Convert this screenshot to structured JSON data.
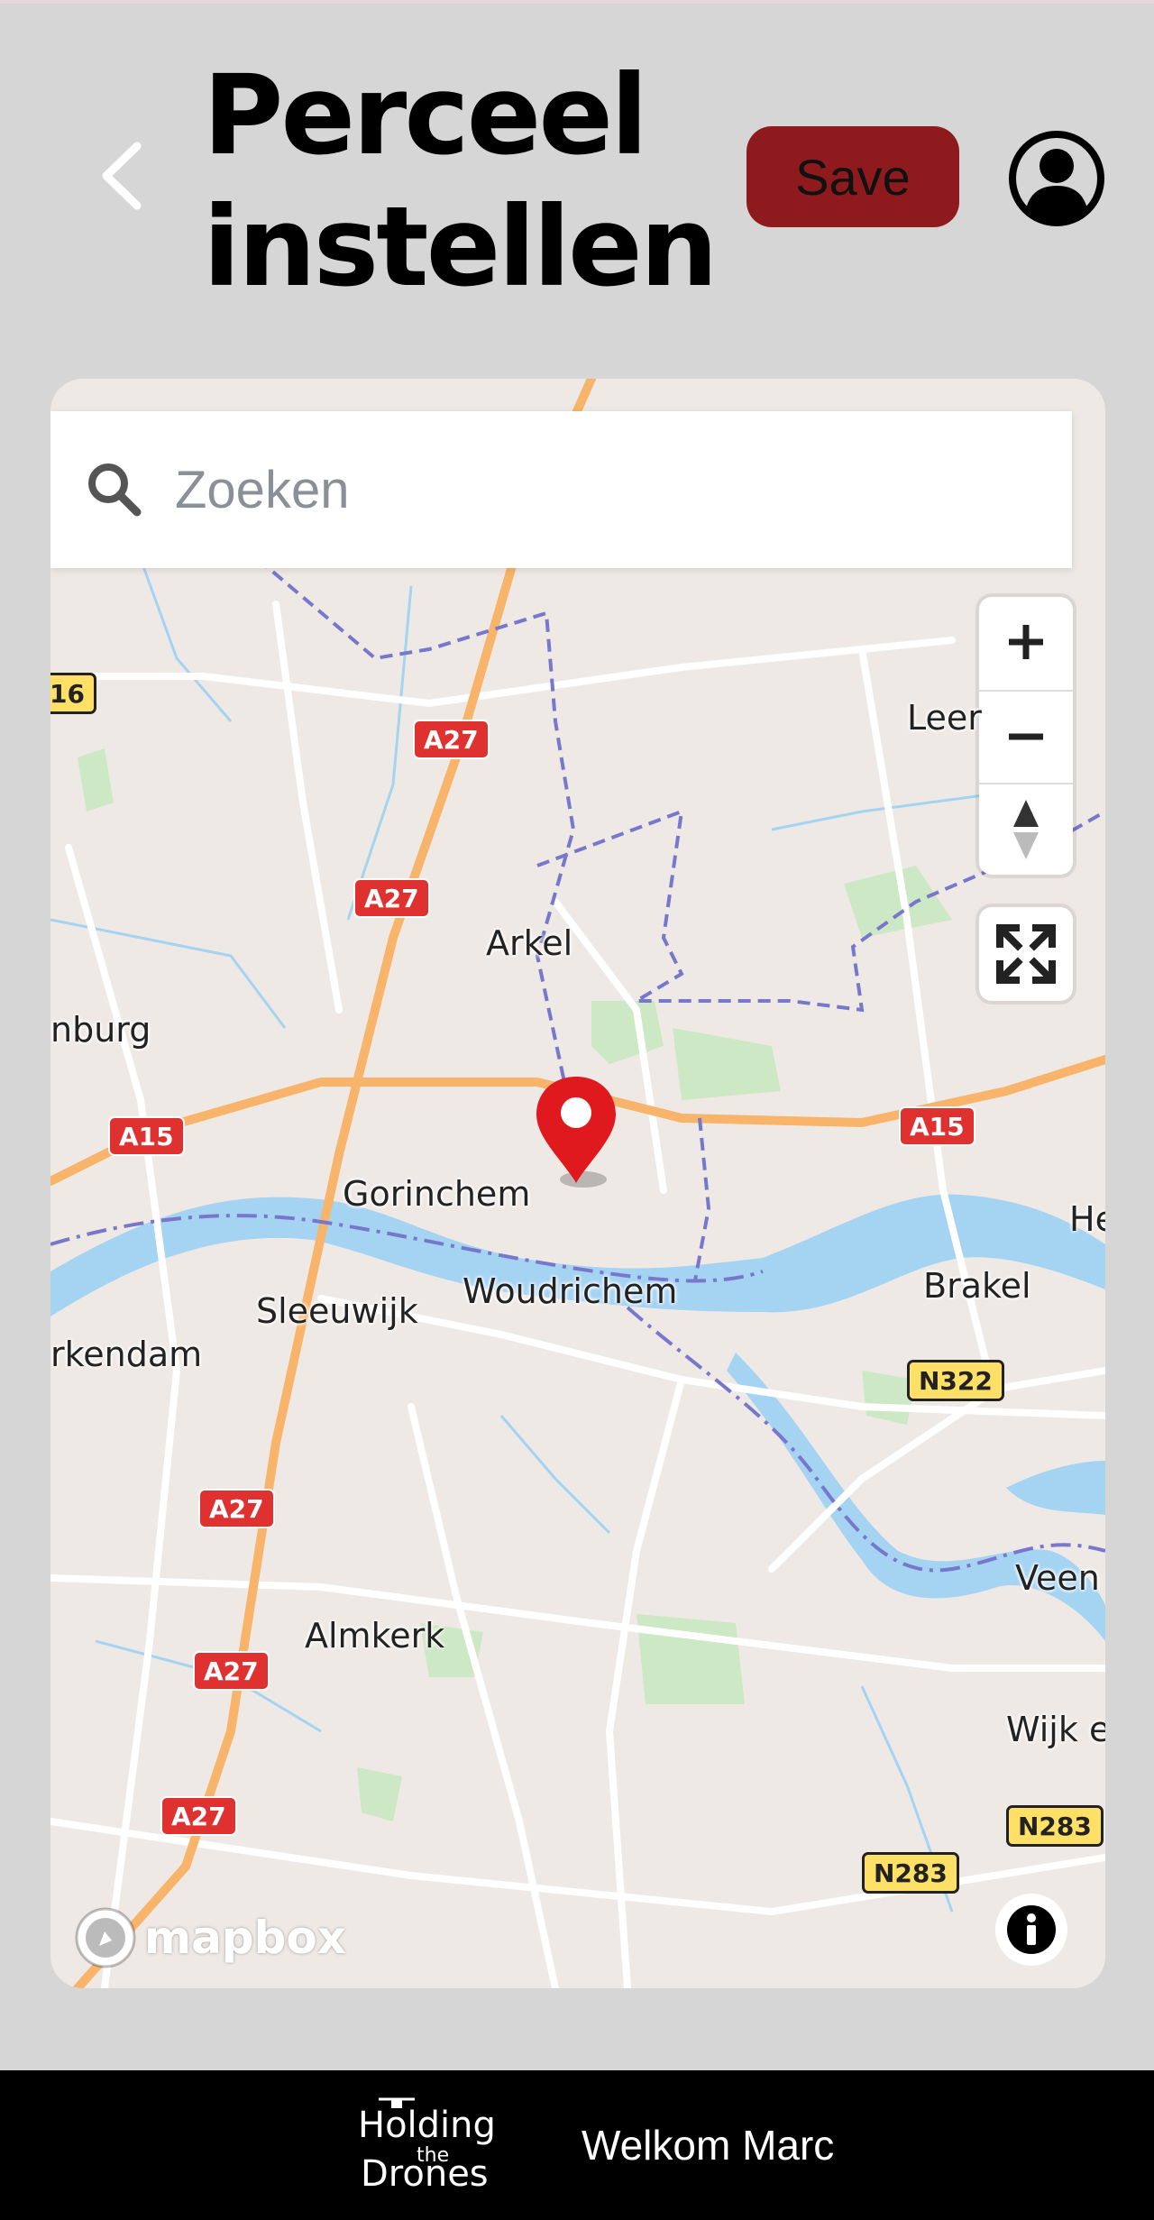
{
  "header": {
    "title": "Perceel instellen",
    "save_label": "Save",
    "back_icon": "chevron-left-icon",
    "avatar_icon": "user-circle-icon",
    "save_color": "#8f1a1d"
  },
  "map": {
    "search_placeholder": "Zoeken",
    "attribution": "mapbox",
    "places": [
      "Leer",
      "Arkel",
      "nburg",
      "Gorinchem",
      "Woudrichem",
      "Sleeuwijk",
      "rkendam",
      "Brakel",
      "He",
      "Veen",
      "Almkerk",
      "Wijk e"
    ],
    "roads": [
      "A27",
      "A27",
      "A27",
      "A27",
      "A27",
      "A15",
      "A15",
      "16",
      "N322",
      "N283",
      "N283"
    ],
    "controls": [
      "zoom-in",
      "zoom-out",
      "compass",
      "fullscreen",
      "info"
    ]
  },
  "footer": {
    "logo_line1": "Holding",
    "logo_line2": "the",
    "logo_line3": "Drones",
    "welcome": "Welkom Marc"
  }
}
